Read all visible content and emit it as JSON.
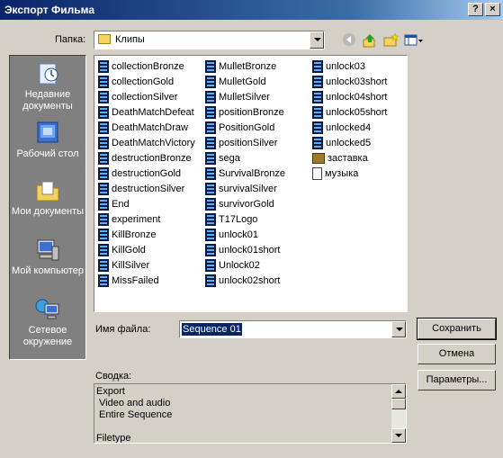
{
  "window": {
    "title": "Экспорт Фильма",
    "help_label": "?",
    "close_label": "×"
  },
  "toolbar": {
    "folder_label": "Папка:",
    "folder_value": "Клипы",
    "back_icon": "back-arrow-icon",
    "up_icon": "up-folder-icon",
    "new_folder_icon": "new-folder-icon",
    "view_icon": "view-menu-icon"
  },
  "places": [
    {
      "label": "Недавние документы",
      "icon": "recent-documents-icon"
    },
    {
      "label": "Рабочий стол",
      "icon": "desktop-icon"
    },
    {
      "label": "Мои документы",
      "icon": "my-documents-icon"
    },
    {
      "label": "Мой компьютер",
      "icon": "my-computer-icon"
    },
    {
      "label": "Сетевое окружение",
      "icon": "network-icon"
    }
  ],
  "files": {
    "col1": [
      "collectionBronze",
      "collectionGold",
      "collectionSilver",
      "DeathMatchDefeat",
      "DeathMatchDraw",
      "DeathMatchVictory",
      "destructionBronze",
      "destructionGold",
      "destructionSilver",
      "End",
      "experiment",
      "KillBronze",
      "KillGold",
      "KillSilver",
      "MissFailed"
    ],
    "col2": [
      "MulletBronze",
      "MulletGold",
      "MulletSilver",
      "positionBronze",
      "PositionGold",
      "positionSilver",
      "sega",
      "SurvivalBronze",
      "survivalSilver",
      "survivorGold",
      "T17Logo",
      "unlock01",
      "unlock01short",
      "Unlock02",
      "unlock02short"
    ],
    "col3": [
      {
        "name": "unlock03",
        "type": "video"
      },
      {
        "name": "unlock03short",
        "type": "video"
      },
      {
        "name": "unlock04short",
        "type": "video"
      },
      {
        "name": "unlock05short",
        "type": "video"
      },
      {
        "name": "unlocked4",
        "type": "video"
      },
      {
        "name": "unlocked5",
        "type": "video"
      },
      {
        "name": "заставка",
        "type": "image"
      },
      {
        "name": "музыка",
        "type": "document"
      }
    ]
  },
  "filename": {
    "label": "Имя файла:",
    "value": "Sequence 01"
  },
  "buttons": {
    "save": "Сохранить",
    "cancel": "Отмена",
    "params": "Параметры..."
  },
  "summary": {
    "label": "Сводка:",
    "lines": [
      "Export",
      "Video and audio",
      "Entire Sequence",
      "",
      "Filetype"
    ]
  },
  "colors": {
    "title_start": "#0a246a",
    "title_end": "#a6caf0",
    "selection": "#0a246a"
  }
}
